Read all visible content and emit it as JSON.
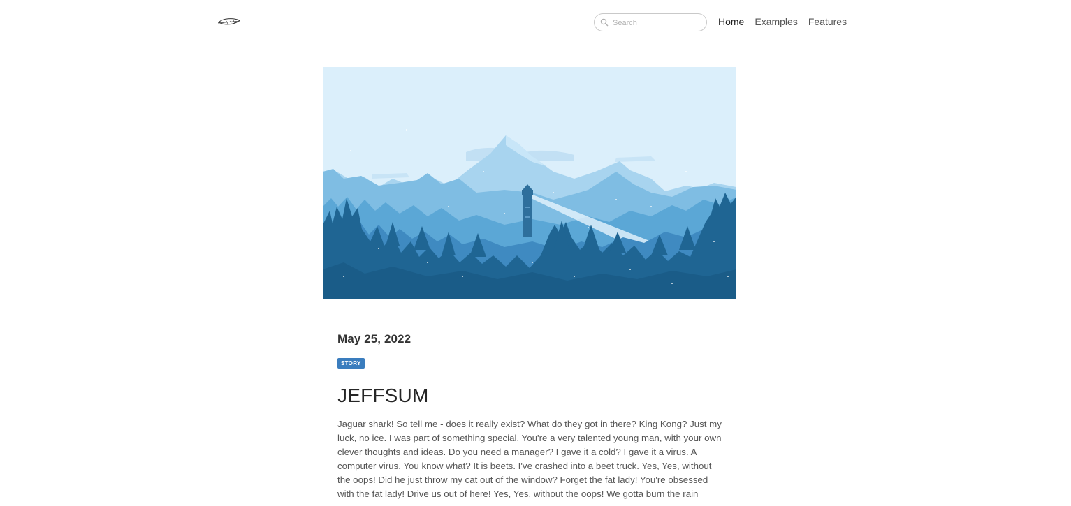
{
  "nav": {
    "logo_icon": "feather-icon",
    "search_placeholder": "Search",
    "links": [
      "Home",
      "Examples",
      "Features"
    ],
    "active": "Home"
  },
  "hero": {
    "description_icon": "lighthouse-mountain-landscape-image"
  },
  "post": {
    "date": "May 25, 2022",
    "tag": "STORY",
    "title": "JEFFSUM",
    "body": "Jaguar shark! So tell me - does it really exist? What do they got in there? King Kong? Just my luck, no ice. I was part of something special. You're a very talented young man, with your own clever thoughts and ideas. Do you need a manager? I gave it a cold? I gave it a virus. A computer virus. You know what? It is beets. I've crashed into a beet truck. Yes, Yes, without the oops! Did he just throw my cat out of the window? Forget the fat lady! You're obsessed with the fat lady! Drive us out of here! Yes, Yes, without the oops! We gotta burn the rain"
  },
  "colors": {
    "badge": "#3a7dbe",
    "sky": "#dbeffb"
  }
}
